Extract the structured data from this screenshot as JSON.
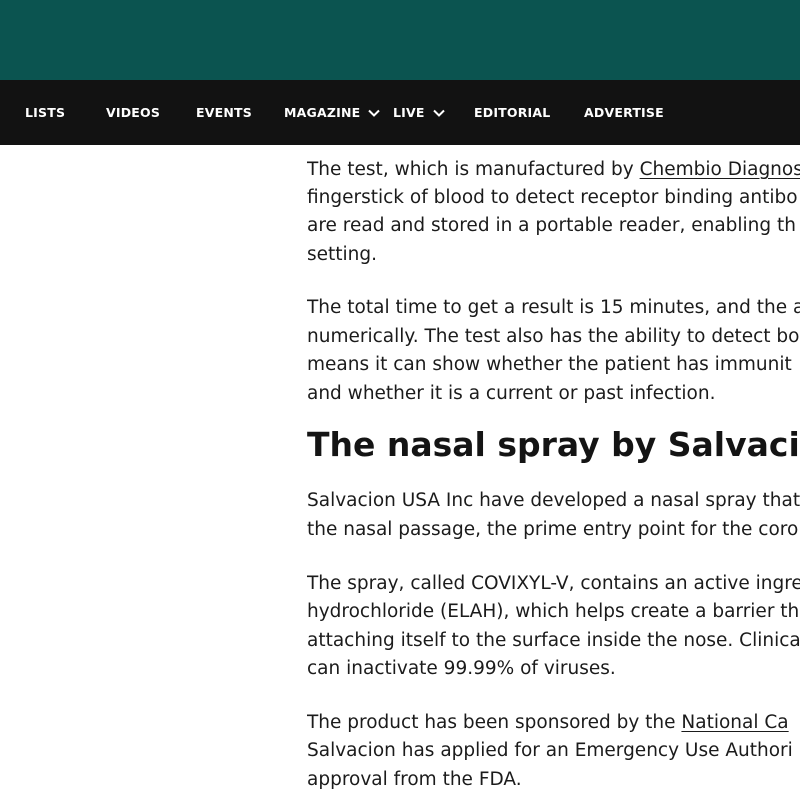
{
  "nav": {
    "items": [
      {
        "label": "LISTS"
      },
      {
        "label": "VIDEOS"
      },
      {
        "label": "EVENTS"
      },
      {
        "label": "MAGAZINE",
        "dropdown": true
      },
      {
        "label": "LIVE",
        "dropdown": true
      },
      {
        "label": "EDITORIAL"
      },
      {
        "label": "ADVERTISE"
      }
    ]
  },
  "article": {
    "p1": {
      "l1_text": "The test, which is manufactured by ",
      "l1_link": "Chembio Diagnos",
      "l2": "fingerstick of blood to detect receptor binding antibo",
      "l3": "are read and stored in a portable reader, enabling th",
      "l4": "setting."
    },
    "p2": {
      "l1": "The total time to get a result is 15 minutes, and the a",
      "l2": "numerically. The test also has the ability to detect bo",
      "l3": "means it can show whether the patient has immunit",
      "l4": "and whether it is a current or past infection."
    },
    "heading": "The nasal spray by Salvacion",
    "p3": {
      "l1": "Salvacion USA Inc have developed a nasal spray that",
      "l2": "the nasal passage, the prime entry point for the coro"
    },
    "p4": {
      "l1": "The spray, called COVIXYL-V, contains an active ingre",
      "l2": "hydrochloride (ELAH), which helps create a barrier th",
      "l3": "attaching itself to the surface inside the nose. Clinica",
      "l4": "can inactivate 99.99% of viruses."
    },
    "p5": {
      "l1_text": "The product has been sponsored by the ",
      "l1_link": "National Ca",
      "l2": "Salvacion has applied for an Emergency Use Authori",
      "l3": "approval from the FDA."
    }
  },
  "colors": {
    "header_band": "#0b5450",
    "navbar": "#121212",
    "nav_text": "#ffffff",
    "body_text": "#1b1b1b"
  }
}
